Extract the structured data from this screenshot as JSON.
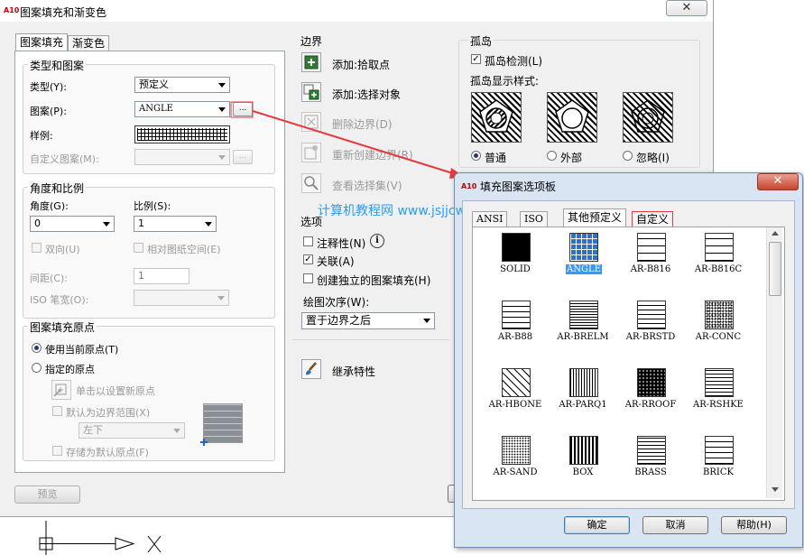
{
  "main": {
    "title": "图案填充和渐变色",
    "app_icon": "A10",
    "close_glyph": "✕",
    "tabs": [
      "图案填充",
      "渐变色"
    ],
    "type_pattern": {
      "legend": "类型和图案",
      "type_label": "类型(Y):",
      "type_value": "预定义",
      "pattern_label": "图案(P):",
      "pattern_value": "ANGLE",
      "browse": "...",
      "swatch_label": "样例:",
      "custom_label": "自定义图案(M):",
      "custom_value": ""
    },
    "angle_scale": {
      "legend": "角度和比例",
      "angle_label": "角度(G):",
      "angle_value": "0",
      "scale_label": "比例(S):",
      "scale_value": "1",
      "double_label": "双向(U)",
      "relative_label": "相对图纸空间(E)",
      "spacing_label": "间距(C):",
      "spacing_value": "1",
      "iso_label": "ISO 笔宽(O):"
    },
    "origin": {
      "legend": "图案填充原点",
      "use_current": "使用当前原点(T)",
      "specified": "指定的原点",
      "click_set": "单击以设置新原点",
      "default_boundary": "默认为边界范围(X)",
      "position_value": "左下",
      "store_default": "存储为默认原点(F)"
    },
    "boundary": {
      "legend": "边界",
      "add_pick": "添加:拾取点",
      "add_select": "添加:选择对象",
      "remove": "删除边界(D)",
      "recreate": "重新创建边界(R)",
      "view": "查看选择集(V)"
    },
    "options": {
      "legend": "选项",
      "annotative": "注释性(N)",
      "associative": "关联(A)",
      "separate": "创建独立的图案填充(H)",
      "draw_order_label": "绘图次序(W):",
      "draw_order_value": "置于边界之后"
    },
    "inherit": "继承特性",
    "islands": {
      "legend": "孤岛",
      "detect": "孤岛检测(L)",
      "style_label": "孤岛显示样式:",
      "normal": "普通",
      "outer": "外部",
      "ignore": "忽略(I)"
    },
    "preview_button": "预览"
  },
  "palette": {
    "title": "填充图案选项板",
    "app_icon": "A10",
    "close_glyph": "✕",
    "tabs": [
      "ANSI",
      "ISO",
      "其他预定义",
      "自定义"
    ],
    "patterns": [
      "SOLID",
      "ANGLE",
      "AR-B816",
      "AR-B816C",
      "AR-B88",
      "AR-BRELM",
      "AR-BRSTD",
      "AR-CONC",
      "AR-HBONE",
      "AR-PARQ1",
      "AR-RROOF",
      "AR-RSHKE",
      "AR-SAND",
      "BOX",
      "BRASS",
      "BRICK"
    ],
    "selected": "ANGLE",
    "ok": "确定",
    "cancel": "取消",
    "help": "帮助(H)"
  },
  "watermark": "计算机教程网 www.jsjjcw.com",
  "colors": {
    "arrow": "#e8383d",
    "selection": "#3399ff",
    "watermark": "#2a9df4"
  }
}
